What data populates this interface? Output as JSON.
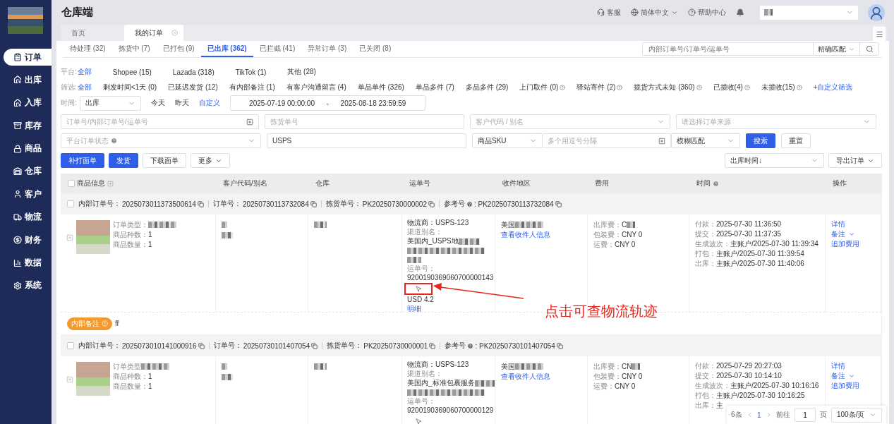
{
  "app": {
    "title": "仓库端"
  },
  "header": {
    "support": "客服",
    "language": "简体中文",
    "help": "帮助中心"
  },
  "sidebar": {
    "items": [
      {
        "label": "订单",
        "selected": true
      },
      {
        "label": "出库",
        "selected": false
      },
      {
        "label": "入库",
        "selected": false
      },
      {
        "label": "库存",
        "selected": false
      },
      {
        "label": "商品",
        "selected": false
      },
      {
        "label": "仓库",
        "selected": false
      },
      {
        "label": "客户",
        "selected": false
      },
      {
        "label": "物流",
        "selected": false
      },
      {
        "label": "财务",
        "selected": false
      },
      {
        "label": "数据",
        "selected": false
      },
      {
        "label": "系统",
        "selected": false
      }
    ]
  },
  "page_tabs": [
    {
      "label": "首页",
      "selected": false,
      "closable": false
    },
    {
      "label": "我的订单",
      "selected": true,
      "closable": true
    }
  ],
  "status_tabs": [
    {
      "label": "待处理 (32)",
      "selected": false
    },
    {
      "label": "拣货中 (7)",
      "selected": false
    },
    {
      "label": "已打包 (9)",
      "selected": false
    },
    {
      "label": "已出库 (362)",
      "selected": true
    },
    {
      "label": "已拦截 (41)",
      "selected": false
    },
    {
      "label": "异常订单 (3)",
      "selected": false
    },
    {
      "label": "已关闭 (8)",
      "selected": false
    }
  ],
  "quick_search": {
    "placeholder": "内部订单号/订单号/运单号",
    "match": "精确匹配"
  },
  "platform_filter": {
    "label": "平台:",
    "options": [
      {
        "label": "全部",
        "selected": true
      },
      {
        "label": "Shopee (15)",
        "selected": false
      },
      {
        "label": "Lazada (318)",
        "selected": false
      },
      {
        "label": "TikTok (1)",
        "selected": false
      },
      {
        "label": "其他 (28)",
        "selected": false
      }
    ]
  },
  "filter": {
    "label": "筛选:",
    "custom": "+自定义筛选",
    "options": [
      {
        "label": "全部",
        "selected": true,
        "help": false
      },
      {
        "label": "剩发时间<1天 (0)",
        "selected": false,
        "help": false
      },
      {
        "label": "已延迟发货 (12)",
        "selected": false,
        "help": false
      },
      {
        "label": "有内部备注 (1)",
        "selected": false,
        "help": false
      },
      {
        "label": "有客户沟通留言 (4)",
        "selected": false,
        "help": false
      },
      {
        "label": "单品单件 (326)",
        "selected": false,
        "help": false
      },
      {
        "label": "单品多件 (7)",
        "selected": false,
        "help": false
      },
      {
        "label": "多品多件 (29)",
        "selected": false,
        "help": false
      },
      {
        "label": "上门取件 (0)",
        "selected": false,
        "help": true
      },
      {
        "label": "驿站寄件 (2)",
        "selected": false,
        "help": true
      },
      {
        "label": "揽货方式未知 (360)",
        "selected": false,
        "help": true
      },
      {
        "label": "已揽收(4)",
        "selected": false,
        "help": true
      },
      {
        "label": "未揽收(15)",
        "selected": false,
        "help": true
      }
    ]
  },
  "time": {
    "label": "时间:",
    "type": "出库",
    "options": [
      {
        "label": "今天",
        "selected": false
      },
      {
        "label": "昨天",
        "selected": false
      },
      {
        "label": "自定义",
        "selected": true
      }
    ],
    "start": "2025-07-19 00:00:00",
    "separator": "-",
    "end": "2025-08-18 23:59:59"
  },
  "search_form": {
    "order_no": {
      "placeholder": "订单号/内部订单号/运单号"
    },
    "picking_no": {
      "placeholder": "拣货单号"
    },
    "customer": {
      "placeholder": "客户代码 / 别名"
    },
    "source": {
      "placeholder": "请选择订单来源"
    },
    "platform_status": {
      "placeholder": "平台订单状态"
    },
    "carrier": {
      "value": "USPS"
    },
    "sku_type": {
      "value": "商品SKU"
    },
    "sku": {
      "placeholder": "多个用逗号分隔"
    },
    "match": {
      "value": "模糊匹配"
    },
    "search": "搜索",
    "reset": "重置"
  },
  "actions": [
    {
      "label": "补打面单",
      "kind": "primary"
    },
    {
      "label": "发货",
      "kind": "primary"
    },
    {
      "label": "下载面单",
      "kind": "default"
    },
    {
      "label": "更多",
      "kind": "dropdown"
    }
  ],
  "sort": {
    "value": "出库时间↓"
  },
  "export": "导出订单",
  "table": {
    "select_all": {
      "checked": false
    },
    "columns": [
      {
        "label": "商品信息",
        "kind": "expand"
      },
      {
        "label": "客户代码/别名",
        "kind": "plain"
      },
      {
        "label": "仓库",
        "kind": "plain"
      },
      {
        "label": "运单号",
        "kind": "plain"
      },
      {
        "label": "收件地区",
        "kind": "plain"
      },
      {
        "label": "费用",
        "kind": "plain"
      },
      {
        "label": "时间",
        "kind": "help"
      },
      {
        "label": "操作",
        "kind": "plain"
      }
    ],
    "orders": [
      {
        "checked": false,
        "ids": [
          {
            "label": "内部订单号：",
            "value": "2025073011373500614",
            "help": false
          },
          {
            "label": "订单号：",
            "value": "20250730113732084",
            "help": false
          },
          {
            "label": "拣货单号：",
            "value": "PK20250730000002",
            "help": false
          },
          {
            "label": "参考号",
            "value": ": PK20250730113732084",
            "help": true
          }
        ],
        "product": [
          {
            "label": "订单类型：",
            "blur": true
          },
          {
            "label": "商品种数：",
            "value": "1",
            "blur": false
          },
          {
            "label": "商品数量：",
            "value": "1",
            "blur": false
          }
        ],
        "logistics": {
          "carrier": "物流商：USPS-123",
          "channel_label": "渠道别名：",
          "channel": "美国内_USPS地",
          "waybill_label": "运单号：",
          "waybill": "9200190369060700000143",
          "tracking_highlighted": true,
          "price": "USD 4.2",
          "detail": "明细"
        },
        "region": {
          "country": "美国",
          "link": "查看收件人信息"
        },
        "fees": [
          {
            "label": "出库费：",
            "value": "C",
            "blur": true
          },
          {
            "label": "包装费：",
            "value": "CNY 0",
            "blur": false
          },
          {
            "label": "运费：",
            "value": "CNY 0",
            "blur": false
          }
        ],
        "times": [
          {
            "label": "付款：",
            "value": "2025-07-30 11:36:50"
          },
          {
            "label": "提交：",
            "value": "2025-07-30 11:37:35"
          },
          {
            "label": "生成波次：",
            "value": "主账户/2025-07-30 11:39:34"
          },
          {
            "label": "打包：",
            "value": "主账户/2025-07-30 11:39:54"
          },
          {
            "label": "出库：",
            "value": "主账户/2025-07-30 11:40:06"
          }
        ],
        "operations": [
          {
            "label": "详情",
            "dropdown": false
          },
          {
            "label": "备注",
            "dropdown": true
          },
          {
            "label": "追加费用",
            "dropdown": false
          }
        ],
        "remark": {
          "label": "内部备注",
          "text": "ff"
        }
      },
      {
        "checked": false,
        "ids": [
          {
            "label": "内部订单号：",
            "value": "2025073010141000916",
            "help": false
          },
          {
            "label": "订单号：",
            "value": "20250730101407054",
            "help": false
          },
          {
            "label": "拣货单号：",
            "value": "PK20250730000001",
            "help": false
          },
          {
            "label": "参考号",
            "value": ": PK20250730101407054",
            "help": true
          }
        ],
        "product": [
          {
            "label": "订单类型",
            "blur": true
          },
          {
            "label": "商品种数：",
            "value": "1",
            "blur": false
          },
          {
            "label": "商品数量：",
            "value": "1",
            "blur": false
          }
        ],
        "logistics": {
          "carrier": "物流商：USPS-123",
          "channel_label": "渠道别名：",
          "channel": "美国内_标准包裹服务",
          "waybill_label": "运单号：",
          "waybill": "9200190369060700000129",
          "tracking_highlighted": false
        },
        "region": {
          "country": "美国",
          "link": "查看收件人信息"
        },
        "fees": [
          {
            "label": "出库费：",
            "value": "CN",
            "blur": true
          },
          {
            "label": "包装费：",
            "value": "CNY 0",
            "blur": false
          },
          {
            "label": "运费：",
            "value": "CNY 0",
            "blur": false
          }
        ],
        "times": [
          {
            "label": "付款：",
            "value": "2025-07-29 20:27:03"
          },
          {
            "label": "提交：",
            "value": "2025-07-30 10:14:10"
          },
          {
            "label": "生成波次：",
            "value": "主账户/2025-07-30 10:16:16"
          },
          {
            "label": "打包：",
            "value": "主账户/2025-07-30 10:16:25"
          },
          {
            "label": "出库：",
            "value": "主"
          }
        ],
        "operations": [
          {
            "label": "详情",
            "dropdown": false
          },
          {
            "label": "备注",
            "dropdown": true
          },
          {
            "label": "追加费用",
            "dropdown": false
          }
        ]
      }
    ]
  },
  "pagination": {
    "total": "6条",
    "page": "1",
    "goto": "前往",
    "goto_value": "1",
    "page_unit": "页",
    "page_size": "100条/页"
  },
  "annotation": {
    "text": "点击可查物流轨迹"
  }
}
